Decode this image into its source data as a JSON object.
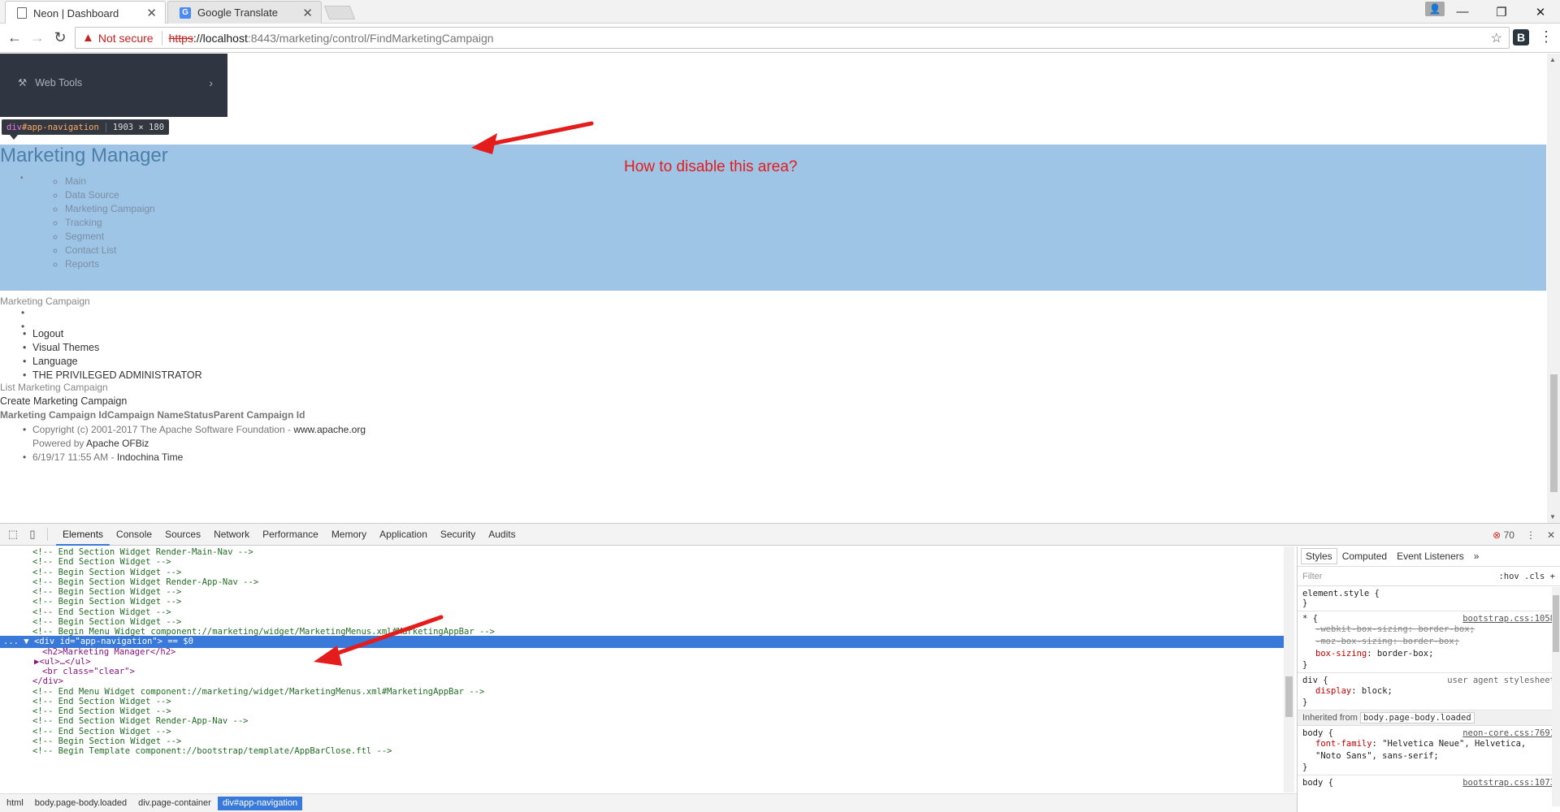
{
  "browser": {
    "tabs": [
      {
        "title": "Neon | Dashboard",
        "active": true
      },
      {
        "title": "Google Translate",
        "active": false
      }
    ],
    "security_label": "Not secure",
    "url_scheme": "https",
    "url_host": "://localhost",
    "url_path": ":8443/marketing/control/FindMarketingCampaign",
    "extension_label": "B"
  },
  "sidebar": {
    "item_label": "Web Tools"
  },
  "inspector_tooltip": {
    "tag": "div",
    "id": "#app-navigation",
    "size": "1903 × 180"
  },
  "annotation": {
    "text": "How to disable this area?",
    "color": "#e51c1c"
  },
  "app_nav": {
    "title": "Marketing Manager",
    "items": [
      "Main",
      "Data Source",
      "Marketing Campaign",
      "Tracking",
      "Segment",
      "Contact List",
      "Reports"
    ],
    "highlight_color": "#9ec4e6"
  },
  "page": {
    "crumb": "Marketing Campaign",
    "user_menu": [
      "Logout",
      "Visual Themes",
      "Language",
      "THE PRIVILEGED ADMINISTRATOR"
    ],
    "list_title": "List Marketing Campaign",
    "create_link": "Create Marketing Campaign",
    "table_headers": [
      "Marketing Campaign Id",
      "Campaign Name",
      "Status",
      "Parent Campaign Id"
    ],
    "footer": {
      "copyright_prefix": "Copyright (c) 2001-2017 The Apache Software Foundation - ",
      "copyright_link": "www.apache.org",
      "powered_prefix": "Powered by ",
      "powered_link": "Apache OFBiz",
      "time_prefix": "6/19/17 11:55 AM - ",
      "time_zone": "Indochina Time"
    }
  },
  "devtools": {
    "tabs": [
      "Elements",
      "Console",
      "Sources",
      "Network",
      "Performance",
      "Memory",
      "Application",
      "Security",
      "Audits"
    ],
    "error_count": "70",
    "dom_lines": [
      {
        "text": "<!-- End Section Widget Render-Main-Nav -->",
        "indent": 40,
        "type": "c"
      },
      {
        "text": "<!-- End Section Widget  -->",
        "indent": 40,
        "type": "c"
      },
      {
        "text": "<!-- Begin Section Widget  -->",
        "indent": 40,
        "type": "c"
      },
      {
        "text": "<!-- Begin Section Widget Render-App-Nav -->",
        "indent": 40,
        "type": "c"
      },
      {
        "text": "<!-- Begin Section Widget  -->",
        "indent": 40,
        "type": "c"
      },
      {
        "text": "<!-- Begin Section Widget  -->",
        "indent": 40,
        "type": "c"
      },
      {
        "text": "<!-- End Section Widget  -->",
        "indent": 40,
        "type": "c"
      },
      {
        "text": "<!-- Begin Section Widget  -->",
        "indent": 40,
        "type": "c"
      },
      {
        "text": "<!-- Begin Menu Widget component://marketing/widget/MarketingMenus.xml#MarketingAppBar -->",
        "indent": 40,
        "type": "c"
      }
    ],
    "selected_line": {
      "prefix": "... ▼",
      "open": "<div ",
      "attr": "id",
      "value": "\"app-navigation\"",
      "close": ">",
      "suffix": " == $0"
    },
    "child_lines": [
      {
        "text": "<h2>Marketing Manager</h2>",
        "indent": 52
      },
      {
        "text": "▶<ul>…</ul>",
        "indent": 42
      },
      {
        "text": "<br class=\"clear\">",
        "indent": 52
      },
      {
        "text": "</div>",
        "indent": 40
      }
    ],
    "tail_lines": [
      "<!-- End Menu Widget component://marketing/widget/MarketingMenus.xml#MarketingAppBar -->",
      "<!-- End Section Widget  -->",
      "<!-- End Section Widget  -->",
      "<!-- End Section Widget Render-App-Nav -->",
      "<!-- End Section Widget  -->",
      "<!-- Begin Section Widget  -->",
      "<!-- Begin Template component://bootstrap/template/AppBarClose.ftl -->"
    ],
    "styles_tabs": [
      "Styles",
      "Computed",
      "Event Listeners"
    ],
    "filter_placeholder": "Filter",
    "filter_controls": ":hov  .cls  +",
    "rules": [
      {
        "selector": "element.style {",
        "source": "",
        "props": [],
        "close": "}"
      },
      {
        "selector": "* {",
        "source": "bootstrap.css:1058",
        "props": [
          {
            "name": "-webkit-box-sizing",
            "value": "border-box;",
            "struck": true
          },
          {
            "name": "-moz-box-sizing",
            "value": "border-box;",
            "struck": true
          },
          {
            "name": "box-sizing",
            "value": "border-box;",
            "struck": false
          }
        ],
        "close": "}"
      },
      {
        "selector": "div {",
        "source": "user agent stylesheet",
        "props": [
          {
            "name": "display",
            "value": "block;",
            "struck": false
          }
        ],
        "close": "}"
      }
    ],
    "inherited_label": "Inherited from",
    "inherited_chip": "body.page-body.loaded",
    "body_rules": [
      {
        "selector": "body {",
        "source": "neon-core.css:7691",
        "props": [
          {
            "name": "font-family",
            "value": "\"Helvetica Neue\", Helvetica, \"Noto Sans\", sans-serif;",
            "struck": false
          }
        ],
        "close": "}"
      },
      {
        "selector": "body {",
        "source": "bootstrap.css:1073",
        "props": [],
        "close": ""
      }
    ],
    "breadcrumbs": [
      "html",
      "body.page-body.loaded",
      "div.page-container",
      "div#app-navigation"
    ]
  }
}
